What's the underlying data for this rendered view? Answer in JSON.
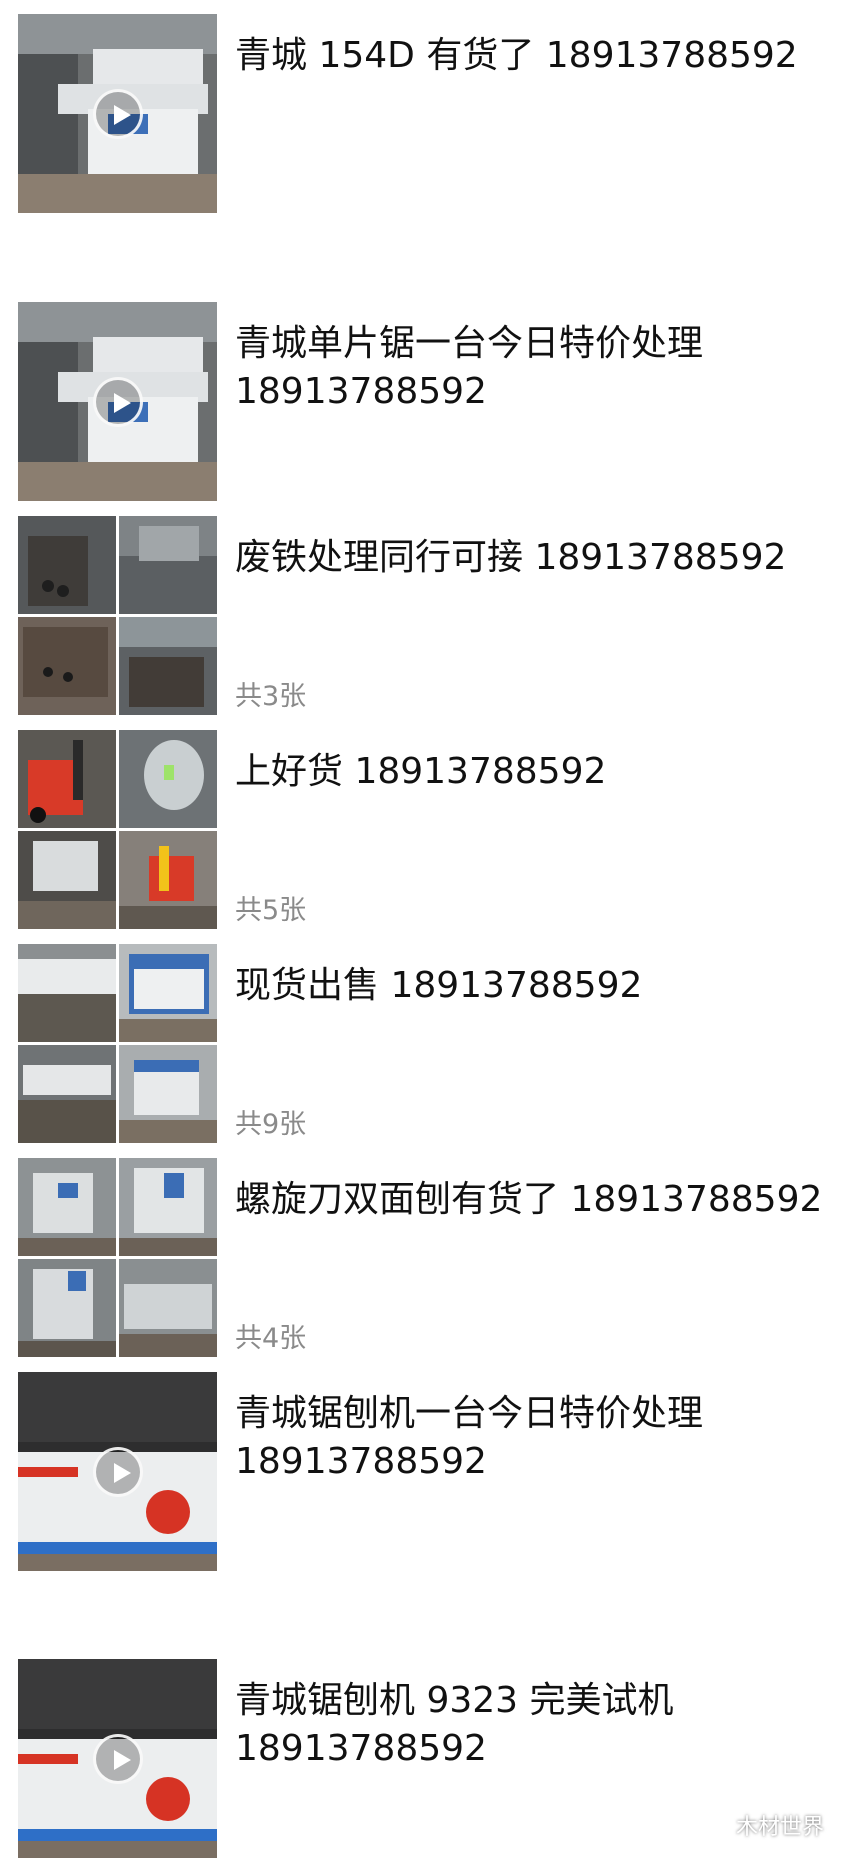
{
  "posts": [
    {
      "text": "青城 154D 有货了 18913788592",
      "media": "video",
      "count_label": ""
    },
    {
      "text": "青城单片锯一台今日特价处理\n18913788592",
      "media": "video",
      "count_label": ""
    },
    {
      "text": "废铁处理同行可接 18913788592",
      "media": "grid",
      "count_label": "共3张"
    },
    {
      "text": "上好货 18913788592",
      "media": "grid",
      "count_label": "共5张"
    },
    {
      "text": "现货出售 18913788592",
      "media": "grid",
      "count_label": "共9张"
    },
    {
      "text": "螺旋刀双面刨有货了 18913788592",
      "media": "grid",
      "count_label": "共4张"
    },
    {
      "text": "青城锯刨机一台今日特价处理\n18913788592",
      "media": "video",
      "count_label": ""
    },
    {
      "text": "青城锯刨机 9323 完美试机\n18913788592",
      "media": "video",
      "count_label": ""
    }
  ],
  "watermark": {
    "label": "木材世界",
    "icon": "wechat-icon"
  },
  "colors": {
    "text": "#111111",
    "muted": "#8a8a8a",
    "background": "#ffffff"
  }
}
